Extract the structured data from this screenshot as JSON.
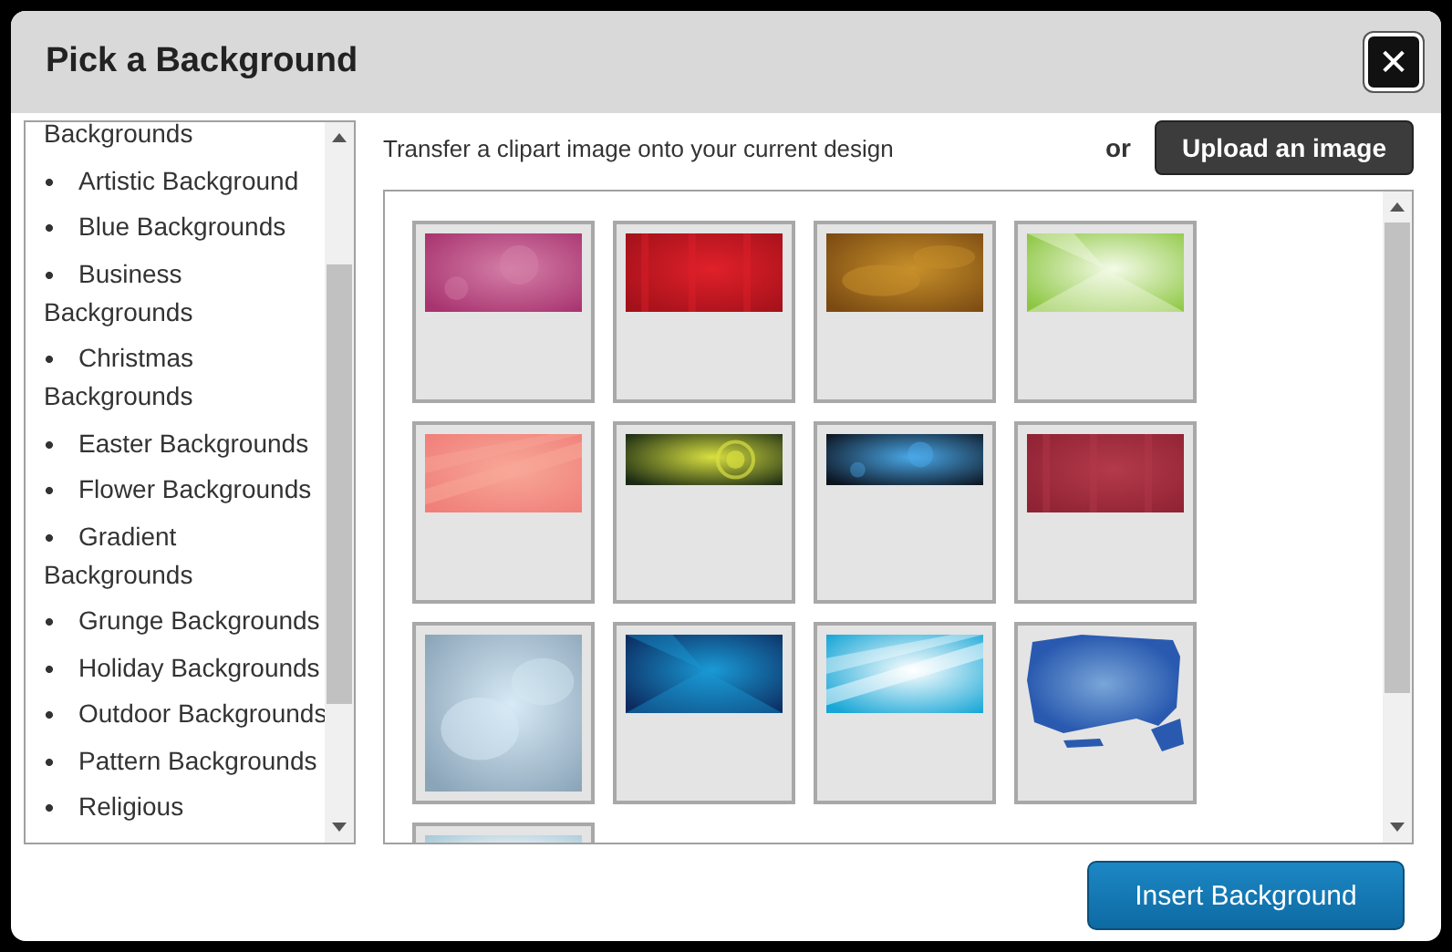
{
  "dialog": {
    "title": "Pick a Background",
    "close_label": "✕"
  },
  "categories": [
    {
      "kind": "continuation",
      "label": "Backgrounds"
    },
    {
      "kind": "item",
      "label": "Artistic Background"
    },
    {
      "kind": "item",
      "label": "Blue Backgrounds"
    },
    {
      "kind": "item",
      "label": "Business Backgrounds"
    },
    {
      "kind": "item",
      "label": "Christmas Backgrounds"
    },
    {
      "kind": "item",
      "label": "Easter Backgrounds"
    },
    {
      "kind": "item",
      "label": "Flower Backgrounds"
    },
    {
      "kind": "item",
      "label": "Gradient Backgrounds"
    },
    {
      "kind": "item",
      "label": "Grunge Backgrounds"
    },
    {
      "kind": "item",
      "label": "Holiday Backgrounds"
    },
    {
      "kind": "item",
      "label": "Outdoor Backgrounds"
    },
    {
      "kind": "item",
      "label": "Pattern Backgrounds"
    },
    {
      "kind": "item",
      "label": "Religious"
    }
  ],
  "intro": "Transfer a clipart image onto your current design",
  "or_label": "or",
  "upload_button": "Upload an image",
  "insert_button": "Insert Background"
}
